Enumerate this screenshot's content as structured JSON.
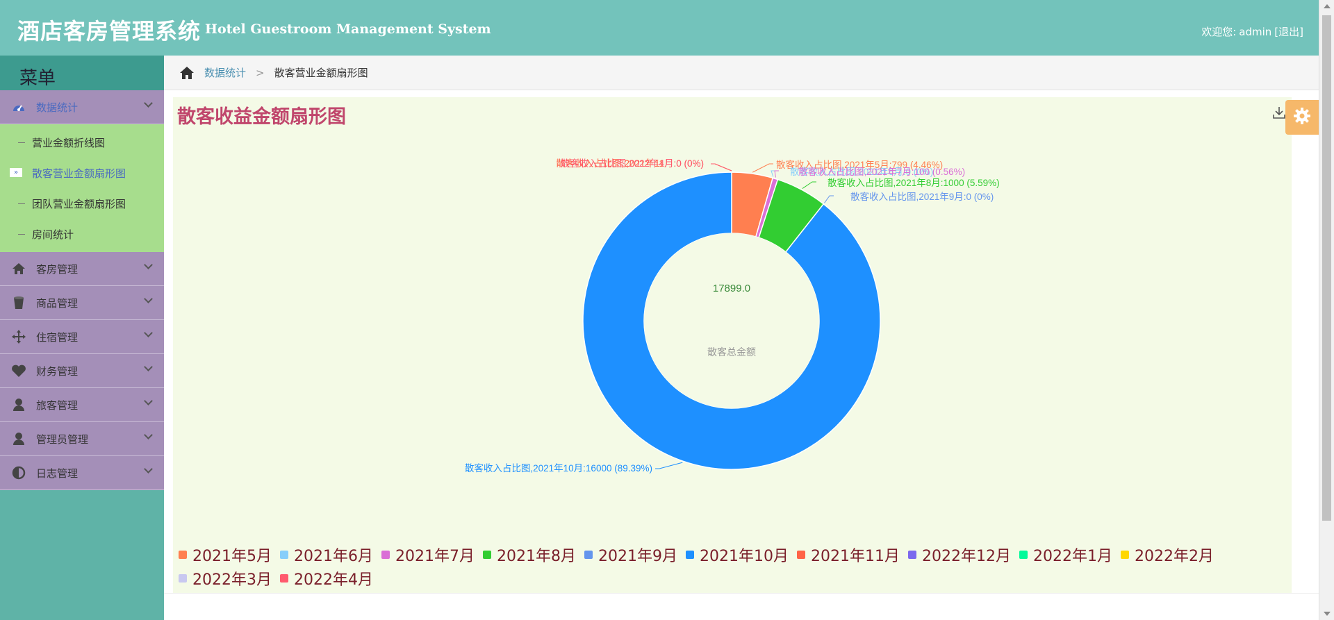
{
  "header": {
    "title": "酒店客房管理系统",
    "subtitle": "Hotel Guestroom Management System",
    "welcome_label": "欢迎您:",
    "username": "admin",
    "logout_label": "[退出]"
  },
  "sidebar": {
    "menu_title": "菜单",
    "sections": [
      {
        "label": "数据统计",
        "icon": "dashboard-icon"
      },
      {
        "label": "客房管理",
        "icon": "home-icon"
      },
      {
        "label": "商品管理",
        "icon": "bucket-icon"
      },
      {
        "label": "住宿管理",
        "icon": "move-icon"
      },
      {
        "label": "财务管理",
        "icon": "heart-icon"
      },
      {
        "label": "旅客管理",
        "icon": "user-icon"
      },
      {
        "label": "管理员管理",
        "icon": "user-icon"
      },
      {
        "label": "日志管理",
        "icon": "contrast-icon"
      }
    ],
    "submenu": [
      {
        "label": "营业金额折线图"
      },
      {
        "label": "散客营业金额扇形图"
      },
      {
        "label": "团队营业金额扇形图"
      },
      {
        "label": "房间统计"
      }
    ],
    "active_marker": "»"
  },
  "breadcrumb": {
    "home_icon": "home-icon",
    "link": "数据统计",
    "separator": ">",
    "current": "散客营业金额扇形图"
  },
  "chart_data": {
    "type": "pie",
    "title": "散客收益金额扇形图",
    "center_value": "17899.0",
    "center_label": "散客总金额",
    "colors": {
      "title": "#c0466c"
    },
    "slices": [
      {
        "name": "2021年5月",
        "value": 799,
        "percent": "4.46%",
        "color": "#ff7f50",
        "label": "散客收入占比图,2021年5月:799  (4.46%)"
      },
      {
        "name": "2021年6月",
        "value": 0,
        "percent": "0%",
        "color": "#87cefa",
        "label": "散客收入占比图,2021年6月:0  (0%)"
      },
      {
        "name": "2021年7月",
        "value": 100,
        "percent": "0.56%",
        "color": "#da70d6",
        "label": "散客收入占比图,2021年7月:100  (0.56%)"
      },
      {
        "name": "2021年8月",
        "value": 1000,
        "percent": "5.59%",
        "color": "#32cd32",
        "label": "散客收入占比图,2021年8月:1000  (5.59%)"
      },
      {
        "name": "2021年9月",
        "value": 0,
        "percent": "0%",
        "color": "#6495ed",
        "label": "散客收入占比图,2021年9月:0  (0%)"
      },
      {
        "name": "2021年10月",
        "value": 16000,
        "percent": "89.39%",
        "color": "#1e90ff",
        "label": "散客收入占比图,2021年10月:16000  (89.39%)"
      },
      {
        "name": "2021年11月",
        "value": 0,
        "percent": "0%",
        "color": "#ff6347",
        "label": "散客收入占比图,2021年11月:0  (0%)"
      },
      {
        "name": "2022年12月",
        "value": 0,
        "percent": "0%",
        "color": "#7b68ee",
        "label": ""
      },
      {
        "name": "2022年1月",
        "value": 0,
        "percent": "0%",
        "color": "#00fa9a",
        "label": ""
      },
      {
        "name": "2022年2月",
        "value": 0,
        "percent": "0%",
        "color": "#ffd700",
        "label": ""
      },
      {
        "name": "2022年3月",
        "value": 0,
        "percent": "0%",
        "color": "#c8c8f0",
        "label": ""
      },
      {
        "name": "2022年4月",
        "value": 0,
        "percent": "0%",
        "color": "#ff5a6e",
        "label": "散客收入占比图,2022年4月:0  (0%)"
      }
    ]
  },
  "settings": {
    "icon": "gear-icon"
  }
}
